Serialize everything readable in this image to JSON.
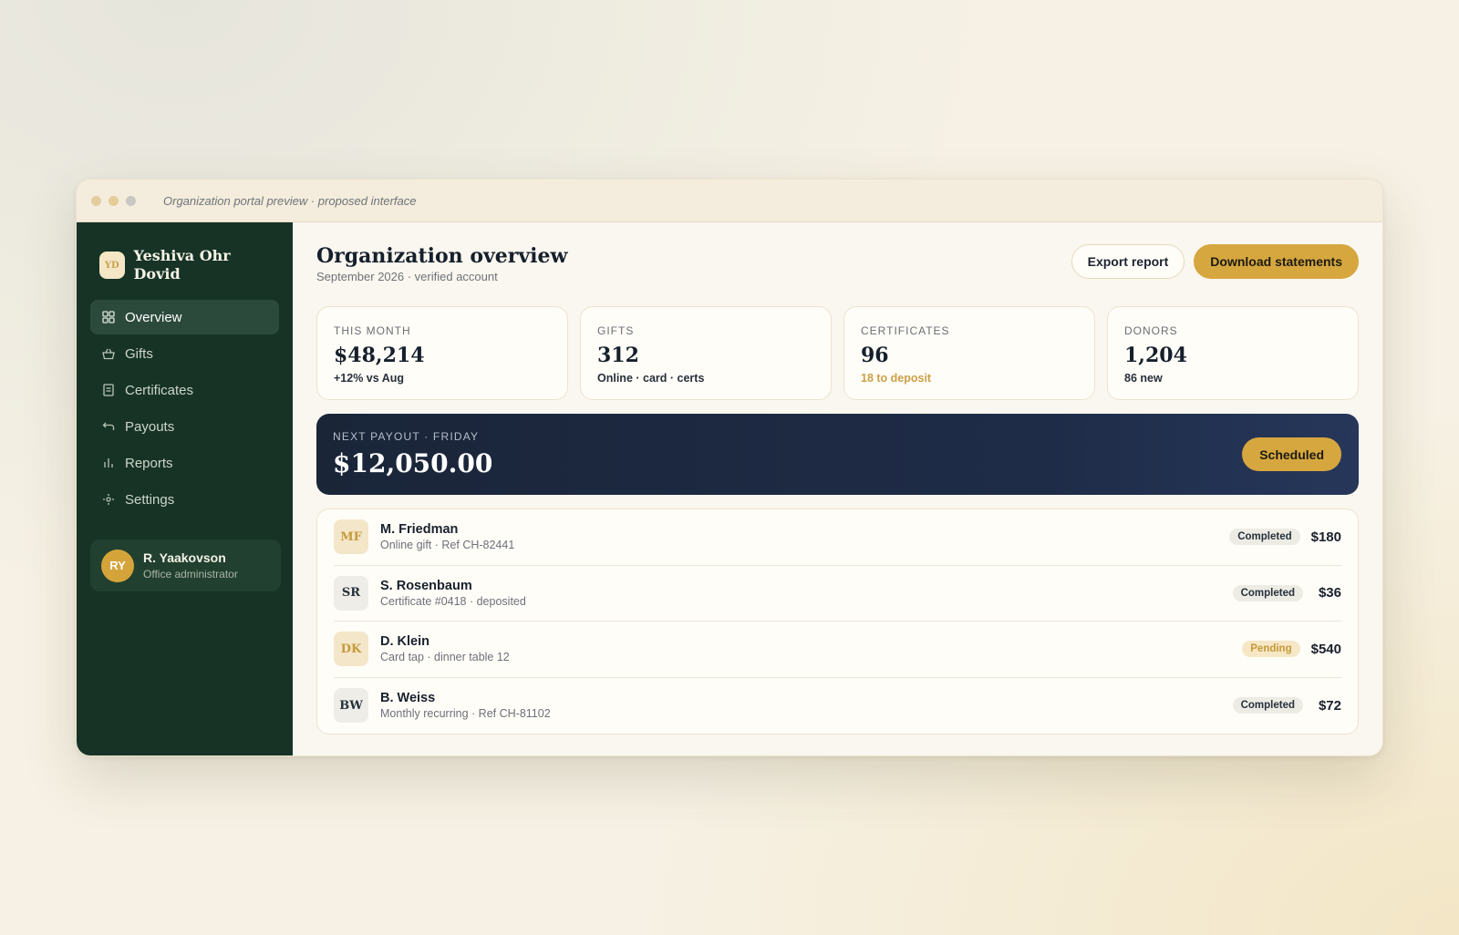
{
  "window": {
    "caption": "Organization portal preview · proposed interface"
  },
  "sidebar": {
    "org_initials": "YD",
    "org_name": "Yeshiva Ohr Dovid",
    "items": [
      {
        "label": "Overview",
        "icon": "grid-icon"
      },
      {
        "label": "Gifts",
        "icon": "basket-icon"
      },
      {
        "label": "Certificates",
        "icon": "document-icon"
      },
      {
        "label": "Payouts",
        "icon": "return-arrow-icon"
      },
      {
        "label": "Reports",
        "icon": "bar-chart-icon"
      },
      {
        "label": "Settings",
        "icon": "settings-icon"
      }
    ],
    "user": {
      "initials": "RY",
      "name": "R. Yaakovson",
      "role": "Office administrator"
    }
  },
  "header": {
    "title": "Organization overview",
    "subtitle": "September 2026 · verified account",
    "export_label": "Export report",
    "download_label": "Download statements"
  },
  "stats": [
    {
      "label": "THIS MONTH",
      "value": "$48,214",
      "note": "+12% vs Aug"
    },
    {
      "label": "GIFTS",
      "value": "312",
      "note": "Online · card · certs"
    },
    {
      "label": "CERTIFICATES",
      "value": "96",
      "note": "18 to deposit"
    },
    {
      "label": "DONORS",
      "value": "1,204",
      "note": "86 new"
    }
  ],
  "payout": {
    "label": "NEXT PAYOUT · FRIDAY",
    "amount": "$12,050.00",
    "status": "Scheduled"
  },
  "transactions": [
    {
      "initials": "MF",
      "name": "M. Friedman",
      "detail": "Online gift · Ref CH-82441",
      "status": "Completed",
      "amount": "$180"
    },
    {
      "initials": "SR",
      "name": "S. Rosenbaum",
      "detail": "Certificate #0418 · deposited",
      "status": "Completed",
      "amount": "$36"
    },
    {
      "initials": "DK",
      "name": "D. Klein",
      "detail": "Card tap · dinner table 12",
      "status": "Pending",
      "amount": "$540"
    },
    {
      "initials": "BW",
      "name": "B. Weiss",
      "detail": "Monthly recurring · Ref CH-81102",
      "status": "Completed",
      "amount": "$72"
    }
  ],
  "colors": {
    "sidebar_bg": "#163326",
    "accent_gold": "#d6a73f",
    "payout_bg": "#1a2538"
  }
}
